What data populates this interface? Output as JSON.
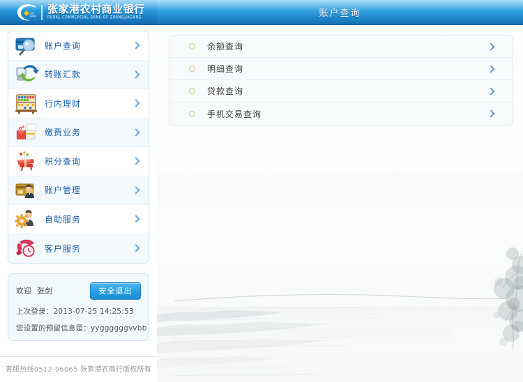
{
  "brand": {
    "name_cn": "张家港农村商业银行",
    "name_en": "RURAL COMMERCIAL BANK OF ZHANGJIAGANG",
    "logo_text_top": "ZRC",
    "logo_text_bottom": "BANK",
    "colors": {
      "header_top": "#6fc3f2",
      "header_bottom": "#1368ab",
      "accent": "#1b5fa8"
    }
  },
  "sidebar": {
    "items": [
      {
        "label": "账户查询",
        "icon": "card-magnifier-icon"
      },
      {
        "label": "转账汇款",
        "icon": "transfer-arrows-icon"
      },
      {
        "label": "行内理财",
        "icon": "abacus-icon"
      },
      {
        "label": "缴费业务",
        "icon": "payment-box-icon"
      },
      {
        "label": "积分查询",
        "icon": "gift-points-icon"
      },
      {
        "label": "账户管理",
        "icon": "card-person-icon"
      },
      {
        "label": "自助服务",
        "icon": "gear-person-icon"
      },
      {
        "label": "客户服务",
        "icon": "phone-clock-icon"
      }
    ]
  },
  "user": {
    "welcome_label": "欢迎",
    "name": "张剑",
    "logout_label": "安全退出",
    "last_login_label": "上次登录：",
    "last_login_value": "2013-07-25 14:25:53",
    "reserved_label": "您设置的预留信息是：",
    "reserved_value": "yyggggggvvbb"
  },
  "footer": {
    "text": "客服热线0512-96065 张家港农商行版权所有"
  },
  "main": {
    "title": "账户查询",
    "menu": [
      {
        "label": "余额查询"
      },
      {
        "label": "明细查询"
      },
      {
        "label": "贷款查询"
      },
      {
        "label": "手机交易查询"
      }
    ],
    "bullet_color": "#d6c377",
    "chevron_color": "#6699cc"
  }
}
